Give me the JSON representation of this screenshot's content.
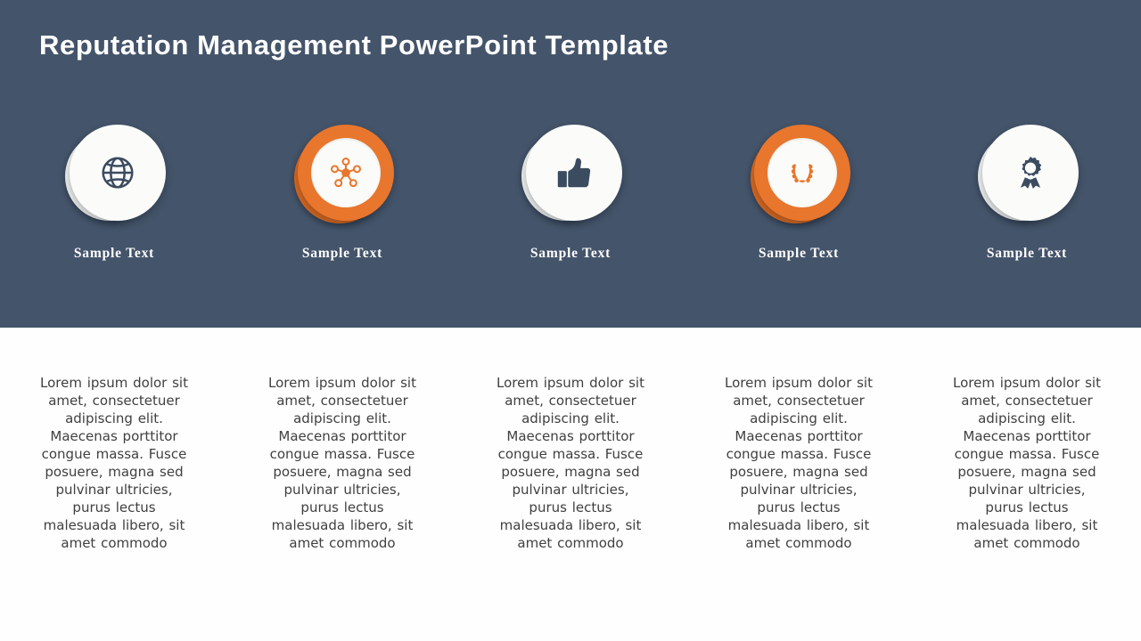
{
  "slide": {
    "title": "Reputation Management PowerPoint Template",
    "header_bg": "#44546a",
    "body_bg": "#fdfefd",
    "accent_orange": "#e8762c",
    "title_color": "#ffffff",
    "body_text_color": "#404040"
  },
  "items": [
    {
      "icon": "globe-icon",
      "icon_style": "plain",
      "label": "Sample Text",
      "body": "Lorem ipsum dolor sit amet, consectetuer adipiscing elit. Maecenas porttitor congue massa. Fusce posuere, magna sed pulvinar ultricies, purus lectus malesuada libero, sit amet commodo"
    },
    {
      "icon": "network-hub-icon",
      "icon_style": "orange-ring",
      "label": "Sample Text",
      "body": "Lorem ipsum dolor sit amet, consectetuer adipiscing elit. Maecenas porttitor congue massa. Fusce posuere, magna sed pulvinar ultricies, purus lectus malesuada libero, sit amet commodo"
    },
    {
      "icon": "thumbs-up-icon",
      "icon_style": "plain",
      "label": "Sample Text",
      "body": "Lorem ipsum dolor sit amet, consectetuer adipiscing elit. Maecenas porttitor congue massa. Fusce posuere, magna sed pulvinar ultricies, purus lectus malesuada libero, sit amet commodo"
    },
    {
      "icon": "laurel-wreath-icon",
      "icon_style": "orange-ring",
      "label": "Sample Text",
      "body": "Lorem ipsum dolor sit amet, consectetuer adipiscing elit. Maecenas porttitor congue massa. Fusce posuere, magna sed pulvinar ultricies, purus lectus malesuada libero, sit amet commodo"
    },
    {
      "icon": "award-ribbon-icon",
      "icon_style": "plain",
      "label": "Sample Text",
      "body": "Lorem ipsum dolor sit amet, consectetuer adipiscing elit. Maecenas porttitor congue massa. Fusce posuere, magna sed pulvinar ultricies, purus lectus malesuada libero, sit amet commodo"
    }
  ]
}
